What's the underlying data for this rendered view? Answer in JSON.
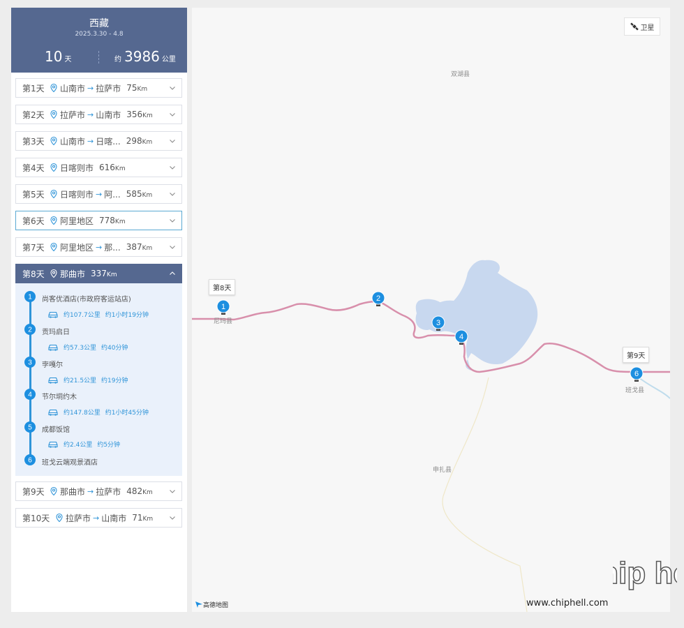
{
  "trip": {
    "title": "西藏",
    "dates": "2025.3.30 - 4.8",
    "days_num": "10",
    "days_unit": "天",
    "dist_prefix": "约",
    "dist_num": "3986",
    "dist_unit": "公里"
  },
  "days": [
    {
      "label": "第1天",
      "route": "山南市",
      "to": "拉萨市",
      "km": "75",
      "unit": "Km"
    },
    {
      "label": "第2天",
      "route": "拉萨市",
      "to": "山南市",
      "km": "356",
      "unit": "Km"
    },
    {
      "label": "第3天",
      "route": "山南市",
      "to": "日喀...",
      "km": "298",
      "unit": "Km"
    },
    {
      "label": "第4天",
      "route": "日喀则市",
      "to": "",
      "km": "616",
      "unit": "Km"
    },
    {
      "label": "第5天",
      "route": "日喀则市",
      "to": "阿...",
      "km": "585",
      "unit": "Km"
    },
    {
      "label": "第6天",
      "route": "阿里地区",
      "to": "",
      "km": "778",
      "unit": "Km"
    },
    {
      "label": "第7天",
      "route": "阿里地区",
      "to": "那...",
      "km": "387",
      "unit": "Km"
    },
    {
      "label": "第8天",
      "route": "那曲市",
      "to": "",
      "km": "337",
      "unit": "Km"
    },
    {
      "label": "第9天",
      "route": "那曲市",
      "to": "拉萨市",
      "km": "482",
      "unit": "Km"
    },
    {
      "label": "第10天",
      "route": "拉萨市",
      "to": "山南市",
      "km": "71",
      "unit": "Km"
    }
  ],
  "arrow": "→",
  "stops": [
    {
      "num": "1",
      "name": "尚客优酒店(市政府客运站店)",
      "dist": "约107.7公里",
      "time": "约1小时19分钟"
    },
    {
      "num": "2",
      "name": "贡玛启日",
      "dist": "约57.3公里",
      "time": "约40分钟"
    },
    {
      "num": "3",
      "name": "孛嘎尔",
      "dist": "约21.5公里",
      "time": "约19分钟"
    },
    {
      "num": "4",
      "name": "节尔垌约木",
      "dist": "约147.8公里",
      "time": "约1小时45分钟"
    },
    {
      "num": "5",
      "name": "成都饭馆",
      "dist": "约2.4公里",
      "time": "约5分钟"
    },
    {
      "num": "6",
      "name": "班戈云端观景酒店",
      "dist": "",
      "time": ""
    }
  ],
  "map": {
    "satellite": "卫星",
    "labels": {
      "shuanghu": "双湖县",
      "nima": "尼玛县",
      "bange": "班戈县",
      "shenzha": "申扎县"
    },
    "day_labels": {
      "start": "第8天",
      "end": "第9天"
    },
    "markers": [
      "1",
      "2",
      "3",
      "4",
      "6"
    ],
    "logo": "高德地图",
    "colors": {
      "route": "#d88fab",
      "lake": "#c8d8ef",
      "marker": "#1d8fe0"
    }
  },
  "watermark": {
    "url": "www.chiphell.com",
    "logo": "chip hell"
  }
}
